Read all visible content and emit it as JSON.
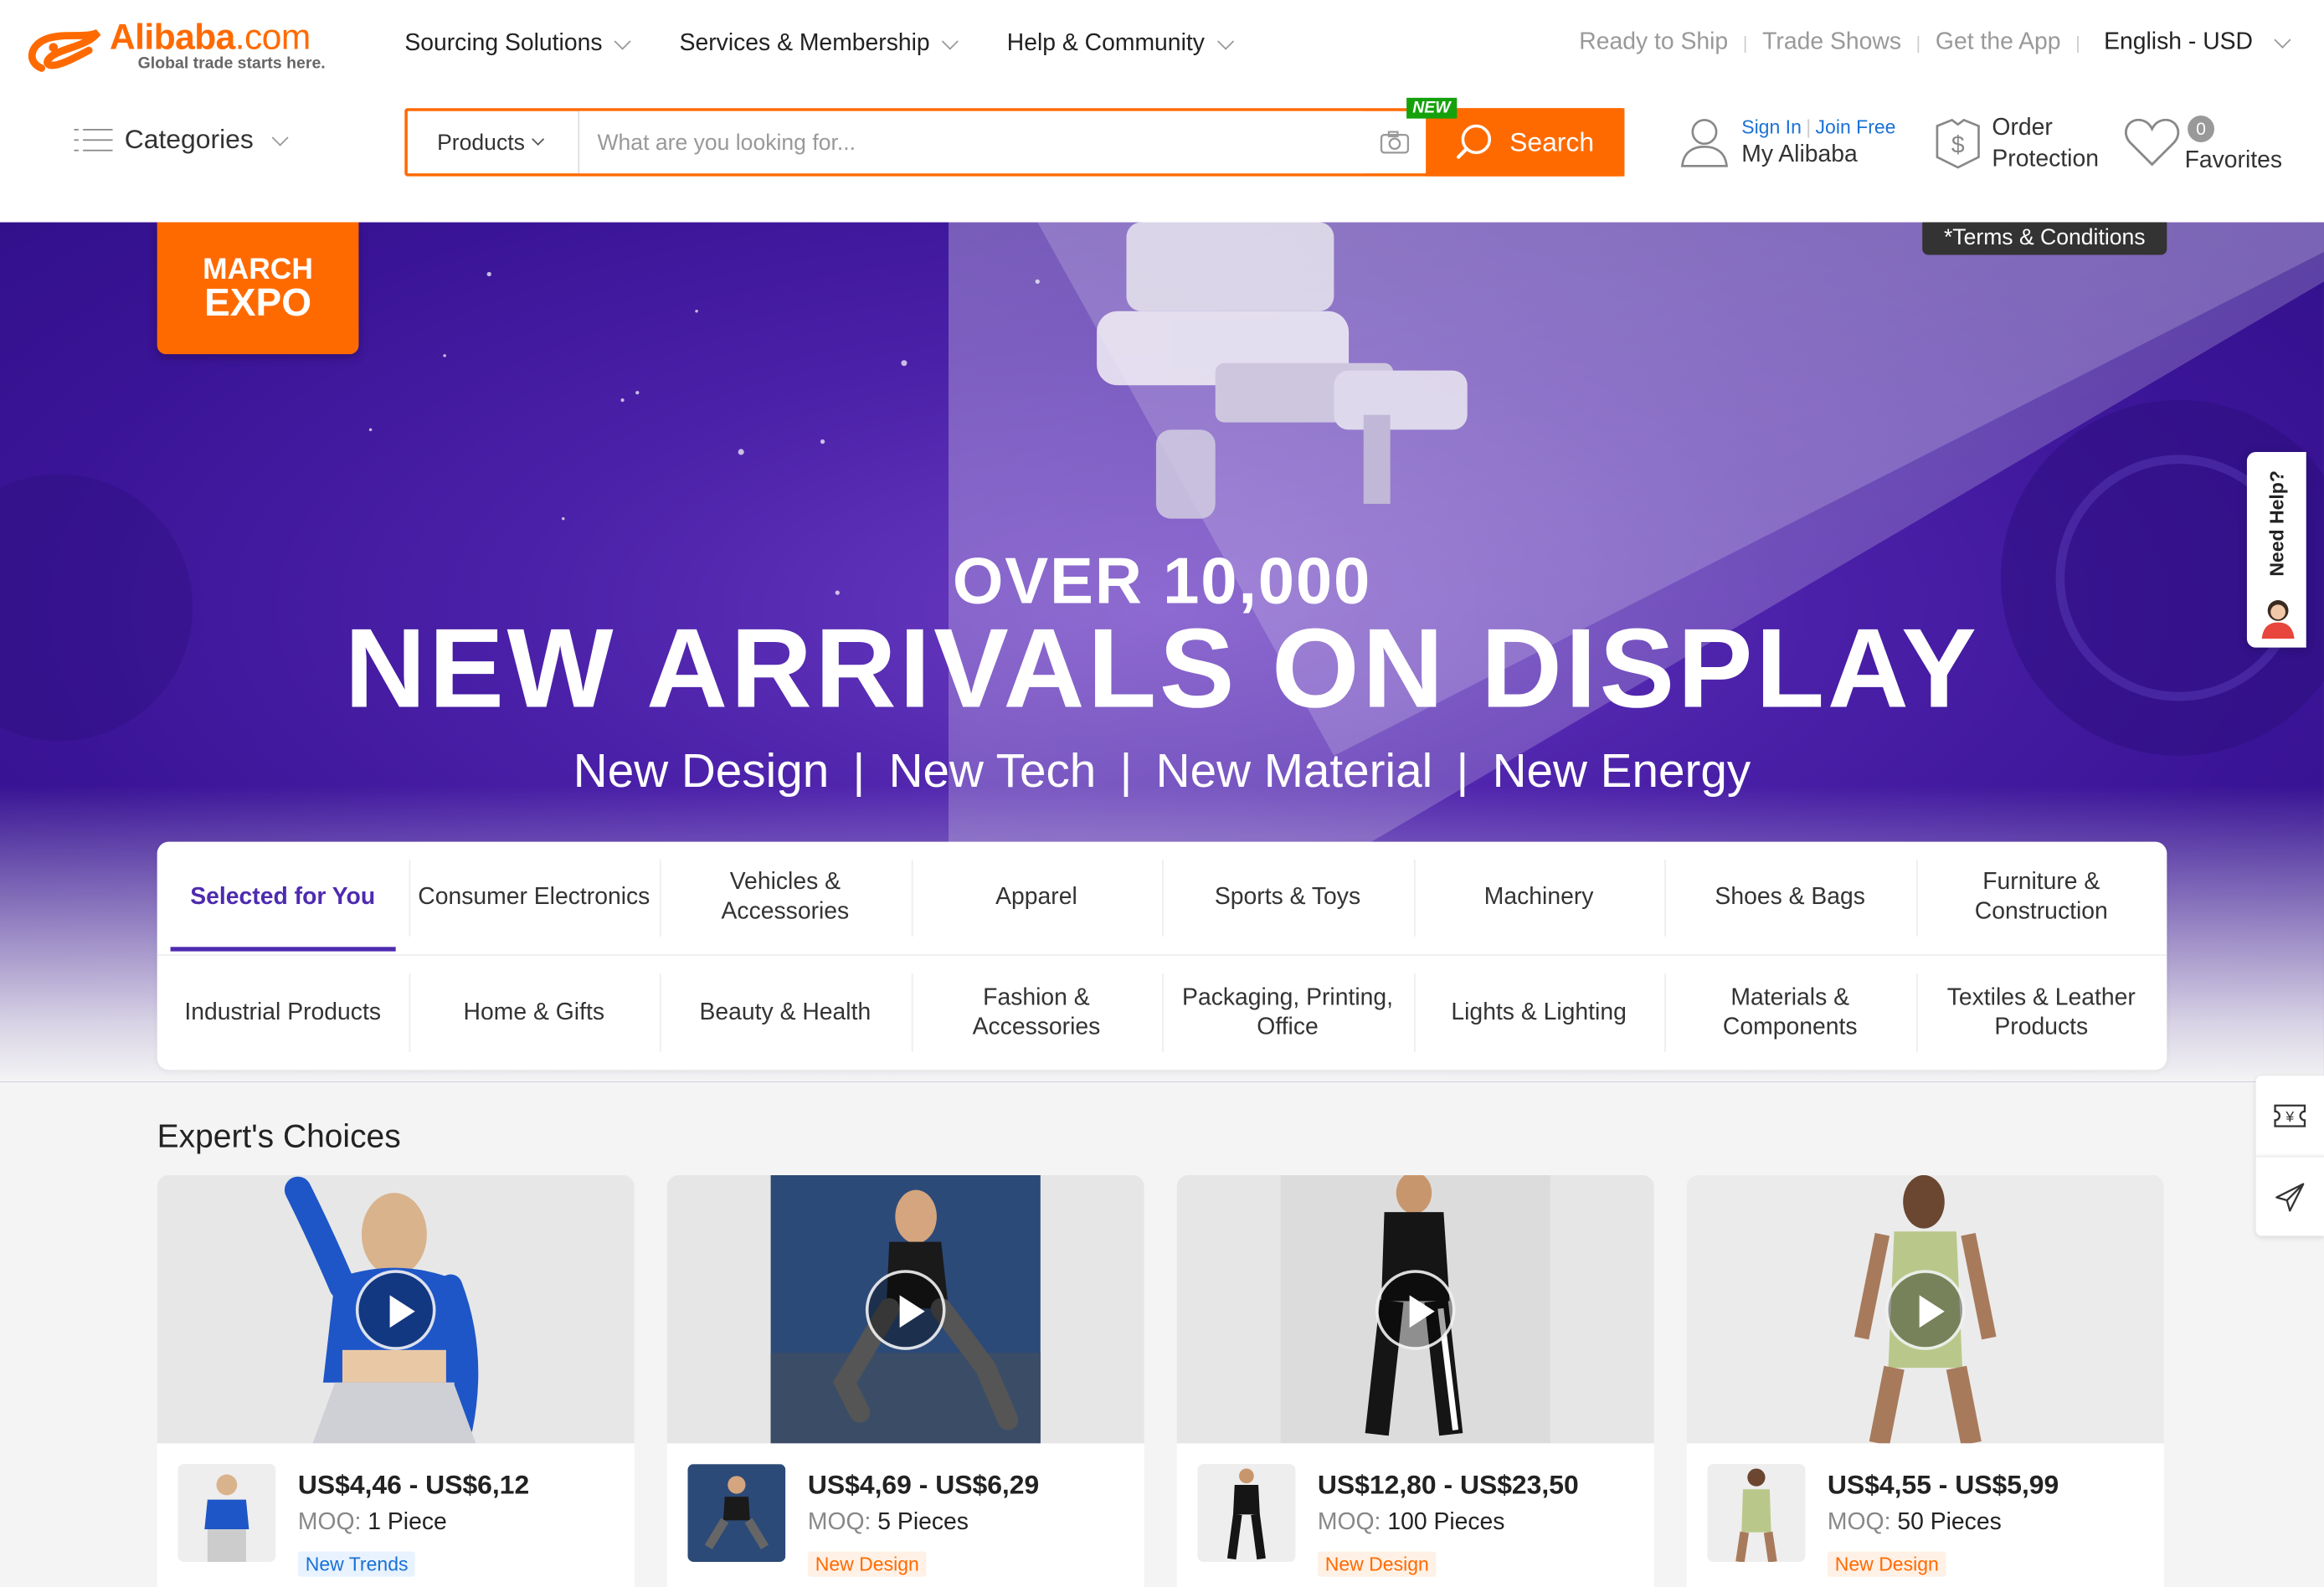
{
  "header": {
    "logo_brand": "Alibaba",
    "logo_suffix": ".com",
    "logo_tagline": "Global trade starts here.",
    "nav": [
      "Sourcing Solutions",
      "Services & Membership",
      "Help & Community"
    ],
    "right_links": [
      "Ready to Ship",
      "Trade Shows",
      "Get the App"
    ],
    "language": "English - USD"
  },
  "search": {
    "categories_label": "Categories",
    "type_label": "Products",
    "placeholder": "What are you looking for...",
    "value": "",
    "button_label": "Search",
    "new_badge": "NEW"
  },
  "account": {
    "sign_in": "Sign In",
    "join": "Join Free",
    "my_alibaba": "My Alibaba",
    "order_line1": "Order",
    "order_line2": "Protection",
    "favorites_label": "Favorites",
    "favorites_count": "0"
  },
  "hero": {
    "badge_line1": "MARCH",
    "badge_line2": "EXPO",
    "terms": "*Terms & Conditions",
    "subtitle": "OVER 10,000",
    "title": "NEW ARRIVALS ON DISPLAY",
    "tags": [
      "New Design",
      "New Tech",
      "New Material",
      "New Energy"
    ],
    "separator": "|"
  },
  "categories": {
    "row1": [
      "Selected for You",
      "Consumer Electronics",
      "Vehicles & Accessories",
      "Apparel",
      "Sports & Toys",
      "Machinery",
      "Shoes & Bags",
      "Furniture & Construction"
    ],
    "row2": [
      "Industrial Products",
      "Home & Gifts",
      "Beauty & Health",
      "Fashion & Accessories",
      "Packaging, Printing, Office",
      "Lights & Lighting",
      "Materials & Components",
      "Textiles & Leather Products"
    ],
    "active": "Selected for You"
  },
  "experts": {
    "title": "Expert's Choices",
    "moq_label": "MOQ:",
    "products": [
      {
        "price": "US$4,46 - US$6,12",
        "moq": "1 Piece",
        "tag": "New Trends",
        "tag_color": "blue"
      },
      {
        "price": "US$4,69 - US$6,29",
        "moq": "5 Pieces",
        "tag": "New Design",
        "tag_color": "orange"
      },
      {
        "price": "US$12,80 - US$23,50",
        "moq": "100 Pieces",
        "tag": "New Design",
        "tag_color": "orange"
      },
      {
        "price": "US$4,55 - US$5,99",
        "moq": "50 Pieces",
        "tag": "New Design",
        "tag_color": "orange"
      }
    ]
  },
  "side": {
    "need_help": "Need Help?"
  },
  "colors": {
    "brand_orange": "#ff6a00",
    "hero_purple": "#4a20a8",
    "active_tab": "#4e2bb0",
    "link_blue": "#1a71d6"
  }
}
